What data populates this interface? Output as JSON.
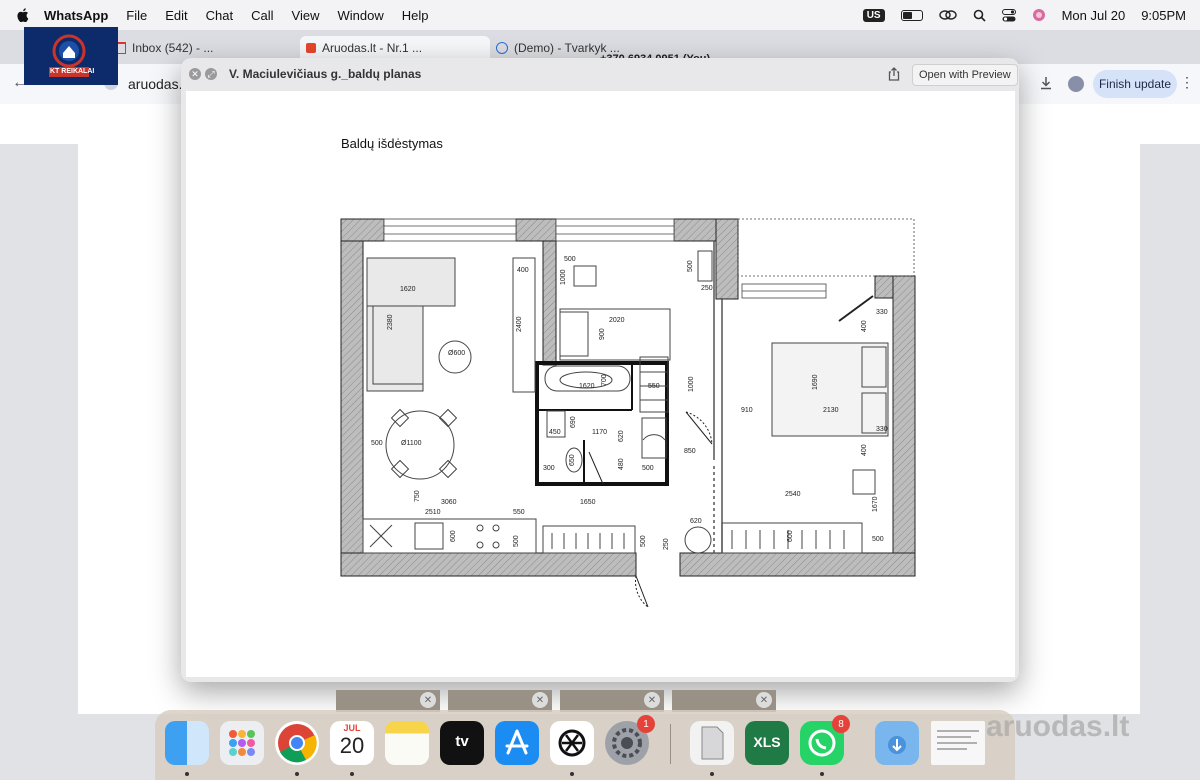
{
  "menubar": {
    "app_name": "WhatsApp",
    "items": [
      "File",
      "Edit",
      "Chat",
      "Call",
      "View",
      "Window",
      "Help"
    ],
    "input_source": "US",
    "date": "Mon Jul 20",
    "time": "9:05PM"
  },
  "browser": {
    "tabs": [
      "Inbox (542) - ...",
      "Aruodas.lt - Nr.1 ...",
      "(Demo) - Tvarkyk ..."
    ],
    "url": "aruodas.lt",
    "finish_update": "Finish update",
    "contact_text": "+370 6934 0951 (You)"
  },
  "logo": {
    "text": "KT REIKALAI"
  },
  "quicklook": {
    "title": "V. Maciulevičiaus g._baldų planas",
    "open_with": "Open with Preview",
    "page_title": "Baldų išdėstymas"
  },
  "plan_dims": {
    "d1620a": "1620",
    "d2380": "2380",
    "d400a": "400",
    "d2400": "2400",
    "d600": "Ø600",
    "d500a": "500",
    "d1100": "Ø1100",
    "d500b": "500",
    "d1000a": "1000",
    "d500c": "500",
    "d250a": "250",
    "d2020": "2020",
    "d900": "900",
    "d1620b": "1620",
    "d700": "700",
    "d550a": "550",
    "d1000b": "1000",
    "d690": "690",
    "d450": "450",
    "d1170": "1170",
    "d620a": "620",
    "d650": "650",
    "d300": "300",
    "d480": "480",
    "d500d": "500",
    "d850": "850",
    "d330a": "330",
    "d400b": "400",
    "d1690": "1690",
    "d910": "910",
    "d2130": "2130",
    "d330b": "330",
    "d400c": "400",
    "d2540": "2540",
    "d1670": "1670",
    "d750": "750",
    "d3060": "3060",
    "d2510": "2510",
    "d550b": "550",
    "d1650": "1650",
    "d620b": "620",
    "d600b": "600",
    "d500e": "500",
    "d500f": "500",
    "d250b": "250",
    "d600c": "600",
    "d500g": "500"
  },
  "dock": {
    "calendar_month": "JUL",
    "calendar_day": "20",
    "settings_badge": "1",
    "whatsapp_badge": "8",
    "excel_label": "XLS"
  },
  "watermark": "aruodas.lt",
  "colors": {
    "wall": "#9a9a9a",
    "accent": "#0a84ff",
    "badge": "#e5433a"
  }
}
